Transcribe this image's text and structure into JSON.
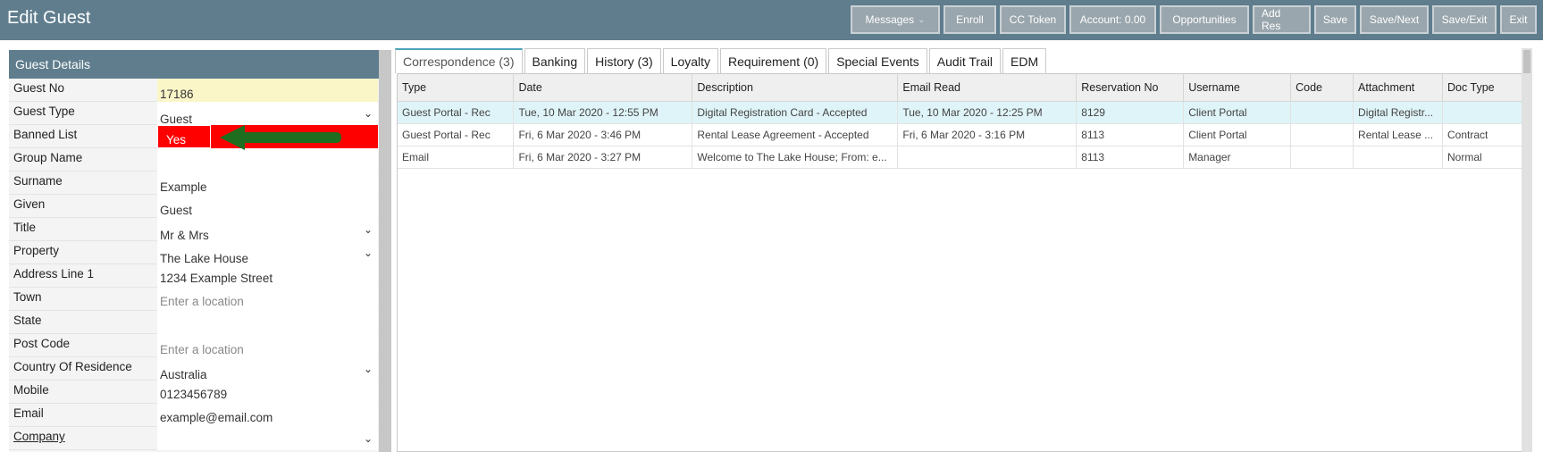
{
  "header": {
    "title": "Edit Guest",
    "buttons": [
      {
        "label": "Messages",
        "has_caret": true
      },
      {
        "label": "Enroll"
      },
      {
        "label": "CC Token"
      },
      {
        "label": "Account: 0.00"
      },
      {
        "label": "Opportunities"
      },
      {
        "label": "Add Res"
      },
      {
        "label": "Save"
      },
      {
        "label": "Save/Next"
      },
      {
        "label": "Save/Exit"
      },
      {
        "label": "Exit"
      }
    ]
  },
  "guest_details": {
    "title": "Guest Details",
    "fields": {
      "guest_no": {
        "label": "Guest No",
        "value": "17186"
      },
      "guest_type": {
        "label": "Guest Type",
        "value": "Guest"
      },
      "banned_list": {
        "label": "Banned List",
        "value": "Yes"
      },
      "group_name": {
        "label": "Group Name",
        "value": ""
      },
      "surname": {
        "label": "Surname",
        "value": "Example"
      },
      "given": {
        "label": "Given",
        "value": "Guest"
      },
      "title": {
        "label": "Title",
        "value": "Mr & Mrs"
      },
      "property": {
        "label": "Property",
        "value": "The Lake House"
      },
      "address_line_1": {
        "label": "Address Line 1",
        "value": "1234 Example Street"
      },
      "town": {
        "label": "Town",
        "value": "",
        "placeholder": "Enter a location"
      },
      "state": {
        "label": "State",
        "value": ""
      },
      "post_code": {
        "label": "Post Code",
        "value": "",
        "placeholder": "Enter a location"
      },
      "country": {
        "label": "Country Of Residence",
        "value": "Australia"
      },
      "mobile": {
        "label": "Mobile",
        "value": "0123456789"
      },
      "email": {
        "label": "Email",
        "value": "example@email.com"
      },
      "company": {
        "label": "Company",
        "value": ""
      }
    }
  },
  "tabs": [
    {
      "label": "Correspondence (3)",
      "active": true
    },
    {
      "label": "Banking"
    },
    {
      "label": "History (3)"
    },
    {
      "label": "Loyalty"
    },
    {
      "label": "Requirement (0)"
    },
    {
      "label": "Special Events"
    },
    {
      "label": "Audit Trail"
    },
    {
      "label": "EDM"
    }
  ],
  "table": {
    "columns": [
      "Type",
      "Date",
      "Description",
      "Email Read",
      "Reservation No",
      "Username",
      "Code",
      "Attachment",
      "Doc Type"
    ],
    "rows": [
      [
        "Guest Portal - Rec",
        "Tue, 10 Mar 2020 - 12:55 PM",
        "Digital Registration Card - Accepted",
        "Tue, 10 Mar 2020 - 12:25 PM",
        "8129",
        "Client Portal",
        "",
        "Digital Registr...",
        ""
      ],
      [
        "Guest Portal - Rec",
        "Fri, 6 Mar 2020 - 3:46 PM",
        "Rental Lease Agreement - Accepted",
        "Fri, 6 Mar 2020 - 3:16 PM",
        "8113",
        "Client Portal",
        "",
        "Rental Lease ...",
        "Contract"
      ],
      [
        "Email",
        "Fri, 6 Mar 2020 - 3:27 PM",
        "Welcome to The Lake House; From: e...",
        "",
        "8113",
        "Manager",
        "",
        "",
        "Normal"
      ]
    ]
  },
  "colors": {
    "header_bg": "#5f7d8d",
    "banned_red": "#ff0000",
    "arrow_green": "#1f6e1f",
    "guest_no_bg": "#fbf6c8",
    "selected_row": "#dff4f8"
  },
  "icons": {
    "dropdown": "chevron-down-icon",
    "arrow": "left-arrow-icon"
  }
}
